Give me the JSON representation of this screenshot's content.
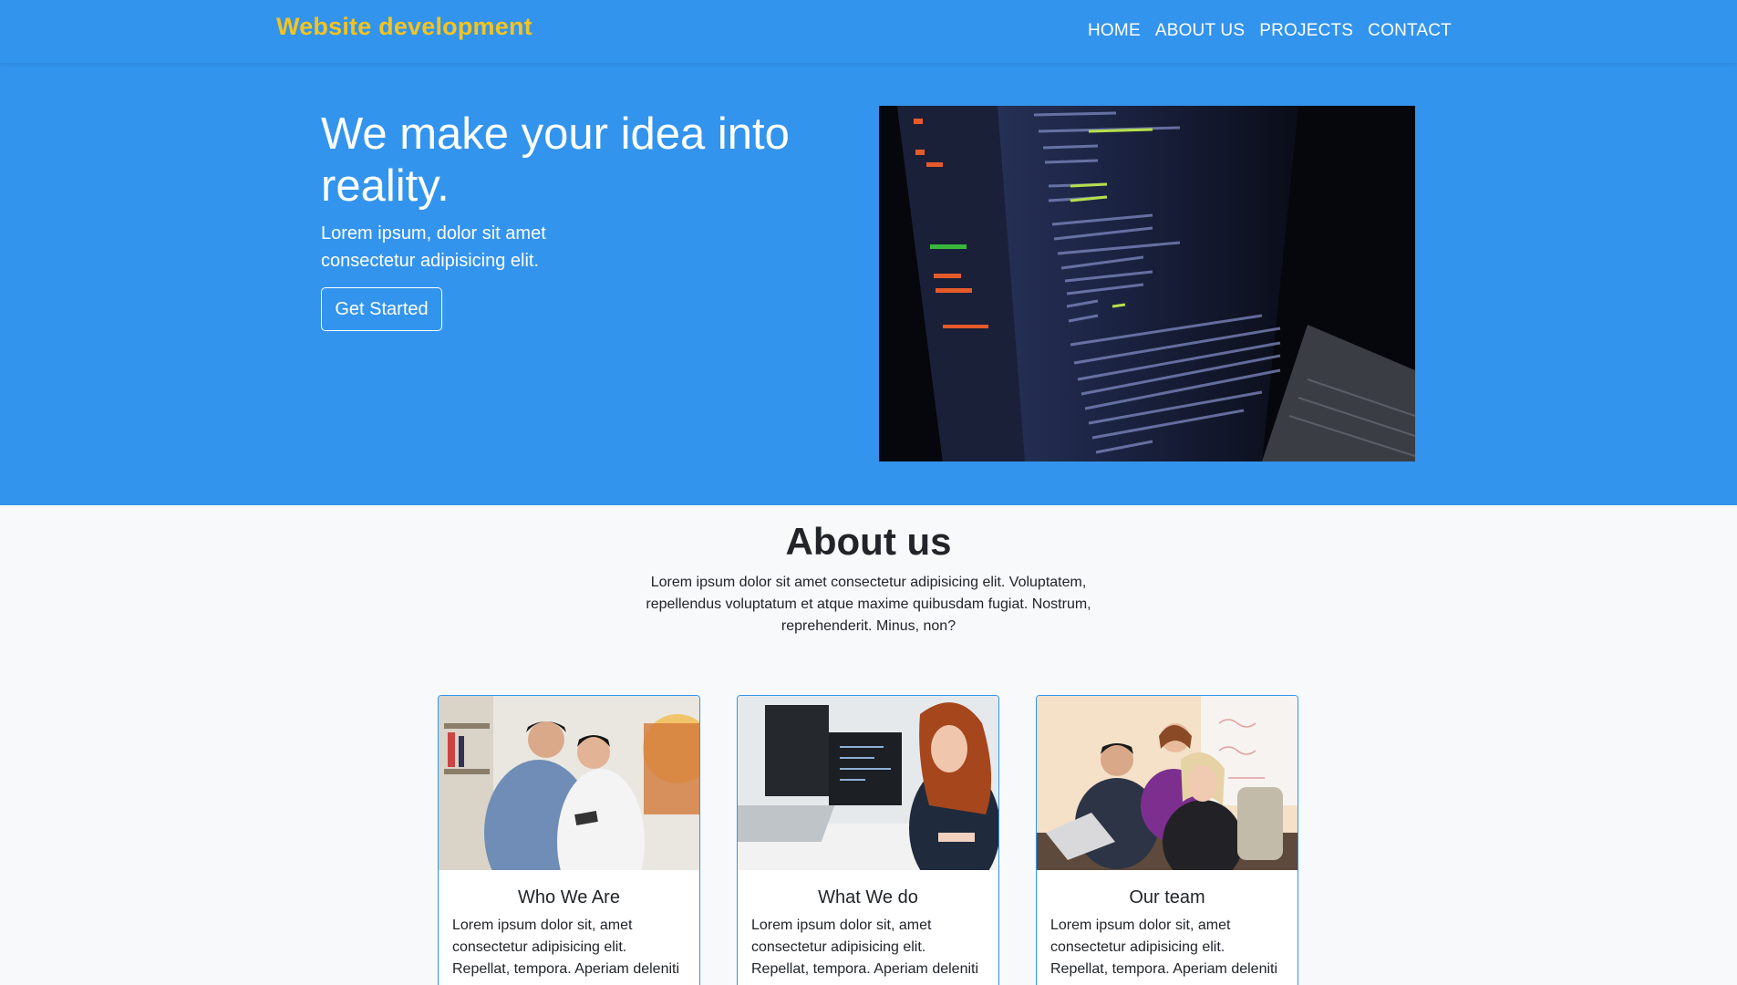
{
  "navbar": {
    "brand": "Website development",
    "links": [
      "HOME",
      "ABOUT US",
      "PROJECTS",
      "CONTACT"
    ]
  },
  "hero": {
    "title": "We make your idea into reality.",
    "subtitle": "Lorem ipsum, dolor sit amet consectetur adipisicing elit.",
    "button_label": "Get Started"
  },
  "about": {
    "title": "About us",
    "text": "Lorem ipsum dolor sit amet consectetur adipisicing elit. Voluptatem, repellendus voluptatum et atque maxime quibusdam fugiat. Nostrum, reprehenderit. Minus, non?",
    "cards": [
      {
        "title": "Who We Are",
        "text": "Lorem ipsum dolor sit, amet consectetur adipisicing elit. Repellat, tempora. Aperiam deleniti"
      },
      {
        "title": "What We do",
        "text": "Lorem ipsum dolor sit, amet consectetur adipisicing elit. Repellat, tempora. Aperiam deleniti"
      },
      {
        "title": "Our team",
        "text": "Lorem ipsum dolor sit, amet consectetur adipisicing elit. Repellat, tempora. Aperiam deleniti"
      }
    ]
  },
  "colors": {
    "primary": "#3394ed",
    "brand": "#f4c41f",
    "background": "#f8f9fa",
    "text": "#212529"
  }
}
